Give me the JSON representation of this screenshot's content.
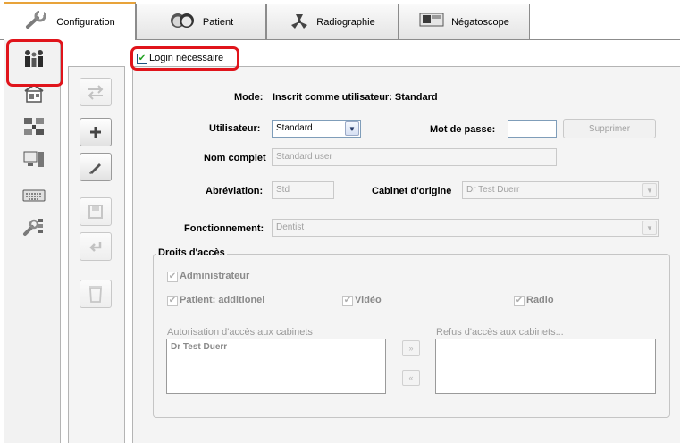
{
  "tabs": [
    {
      "label": "Configuration",
      "icon": "wrench-icon",
      "active": true
    },
    {
      "label": "Patient",
      "icon": "patient-faces-icon",
      "active": false
    },
    {
      "label": "Radiographie",
      "icon": "radiation-icon",
      "active": false
    },
    {
      "label": "Négatoscope",
      "icon": "xray-viewer-icon",
      "active": false
    }
  ],
  "sidebar": {
    "items": [
      {
        "icon": "users-icon",
        "selected": true
      },
      {
        "icon": "building-icon"
      },
      {
        "icon": "network-icon"
      },
      {
        "icon": "computer-icon"
      },
      {
        "icon": "keyboard-icon"
      },
      {
        "icon": "tools-settings-icon"
      }
    ]
  },
  "actions": {
    "items": [
      "switch-user-icon",
      "add-icon",
      "edit-icon",
      "save-icon",
      "undo-icon",
      "delete-icon"
    ]
  },
  "login": {
    "label": "Login nécessaire",
    "checked": true
  },
  "mode": {
    "label": "Mode:",
    "value": "Inscrit comme utilisateur: Standard"
  },
  "user": {
    "label": "Utilisateur:",
    "value": "Standard"
  },
  "password": {
    "label": "Mot de passe:",
    "value": ""
  },
  "delete_button": "Supprimer",
  "fullname": {
    "label": "Nom complet",
    "value": "Standard user"
  },
  "abbreviation": {
    "label": "Abréviation:",
    "value": "Std"
  },
  "home_office": {
    "label": "Cabinet d'origine",
    "value": "Dr Test Duerr"
  },
  "function": {
    "label": "Fonctionnement:",
    "value": "Dentist"
  },
  "rights": {
    "title": "Droits d'accès",
    "administrator": "Administrateur",
    "patient_additional": "Patient: additionel",
    "video": "Vidéo",
    "radio": "Radio",
    "allowed_label": "Autorisation d'accès aux cabinets",
    "allowed_items": [
      "Dr Test Duerr"
    ],
    "denied_label": "Refus d'accès aux cabinets...",
    "move_right": "»",
    "move_left": "«"
  },
  "colors": {
    "highlight": "#e0141b",
    "active_tab_accent": "#e8a33a",
    "check_mark": "#21a121"
  }
}
